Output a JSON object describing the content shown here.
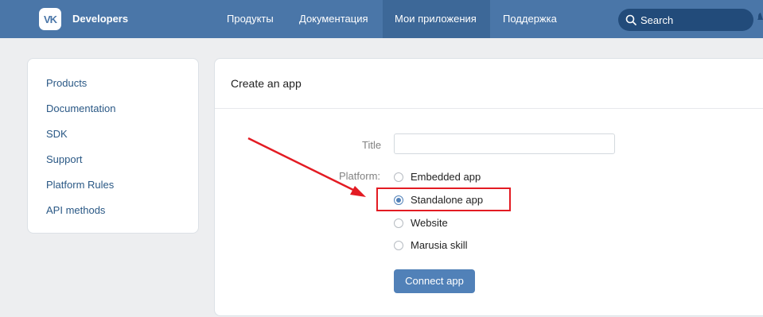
{
  "header": {
    "brand": "Developers",
    "logo_text": "VK",
    "nav": [
      {
        "label": "Продукты"
      },
      {
        "label": "Документация"
      },
      {
        "label": "Мои приложения",
        "active": true
      },
      {
        "label": "Поддержка"
      }
    ],
    "search_label": "Search",
    "search_icon": "search-icon"
  },
  "sidebar": {
    "items": [
      {
        "label": "Products"
      },
      {
        "label": "Documentation"
      },
      {
        "label": "SDK"
      },
      {
        "label": "Support"
      },
      {
        "label": "Platform Rules"
      },
      {
        "label": "API methods"
      }
    ]
  },
  "form": {
    "heading": "Create an app",
    "title_label": "Title",
    "title_value": "",
    "platform_label": "Platform:",
    "options": [
      {
        "label": "Embedded app",
        "checked": false
      },
      {
        "label": "Standalone app",
        "checked": true
      },
      {
        "label": "Website",
        "checked": false
      },
      {
        "label": "Marusia skill",
        "checked": false
      }
    ],
    "submit_label": "Connect app"
  },
  "colors": {
    "header_bg": "#4a76a8",
    "accent": "#5181b8",
    "annotation_red": "#e31b23"
  }
}
